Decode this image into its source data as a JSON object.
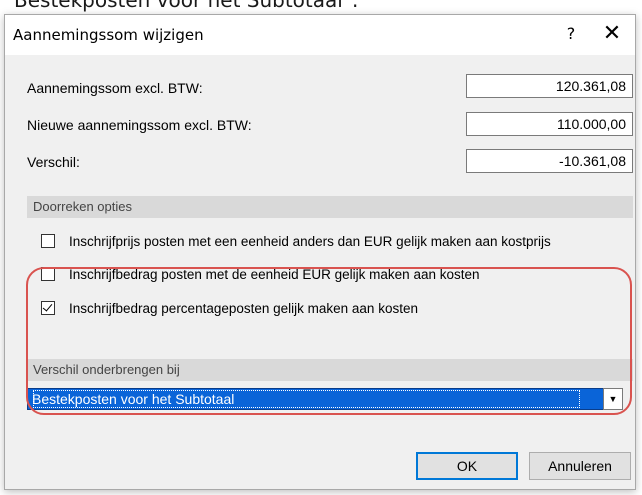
{
  "background": {
    "caption": "Bestekposten voor het Subtotaal\"."
  },
  "dialog": {
    "title": "Aannemingssom wijzigen",
    "help_label": "?",
    "close_label": "✕"
  },
  "fields": [
    {
      "label": "Aannemingssom excl. BTW:",
      "value": "120.361,08"
    },
    {
      "label": "Nieuwe aannemingssom excl. BTW:",
      "value": "110.000,00"
    },
    {
      "label": "Verschil:",
      "value": "-10.361,08"
    }
  ],
  "options": {
    "header": "Doorreken opties",
    "checkboxes": [
      {
        "label": "Inschrijfprijs posten met een eenheid anders dan EUR gelijk maken aan kostprijs",
        "checked": false
      },
      {
        "label": "Inschrijfbedrag posten met de eenheid EUR gelijk maken aan kosten",
        "checked": false
      },
      {
        "label": "Inschrijfbedrag percentageposten gelijk maken aan kosten",
        "checked": true
      }
    ]
  },
  "allocation": {
    "header": "Verschil onderbrengen bij",
    "selected": "Bestekposten voor het Subtotaal"
  },
  "buttons": {
    "ok": "OK",
    "cancel": "Annuleren"
  },
  "colors": {
    "highlight_outline": "#d9534f",
    "select_bg": "#0a64d8"
  }
}
